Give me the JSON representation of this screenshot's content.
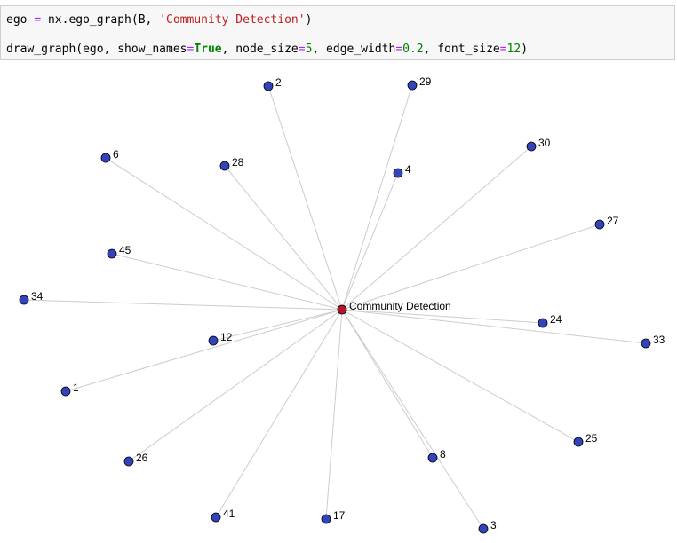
{
  "code": {
    "line1": {
      "var": "ego",
      "op": "=",
      "call": "nx.ego_graph(B,",
      "str": "'Community Detection'",
      "close": ")"
    },
    "line2": {
      "fn": "draw_graph(ego, show_names",
      "eq1": "=",
      "kw": "True",
      "p2": ", node_size",
      "eq2": "=",
      "n1": "5",
      "p3": ", edge_width",
      "eq3": "=",
      "n2": "0.2",
      "p4": ", font_size",
      "eq4": "=",
      "n3": "12",
      "close": ")"
    }
  },
  "graph": {
    "center_label": "Community Detection",
    "colors": {
      "center": "#b5122b",
      "node": "#3344bb",
      "edge": "#cccccc"
    },
    "nodes": [
      "2",
      "29",
      "6",
      "28",
      "4",
      "30",
      "27",
      "45",
      "34",
      "24",
      "33",
      "12",
      "1",
      "25",
      "26",
      "8",
      "41",
      "17",
      "3"
    ]
  }
}
